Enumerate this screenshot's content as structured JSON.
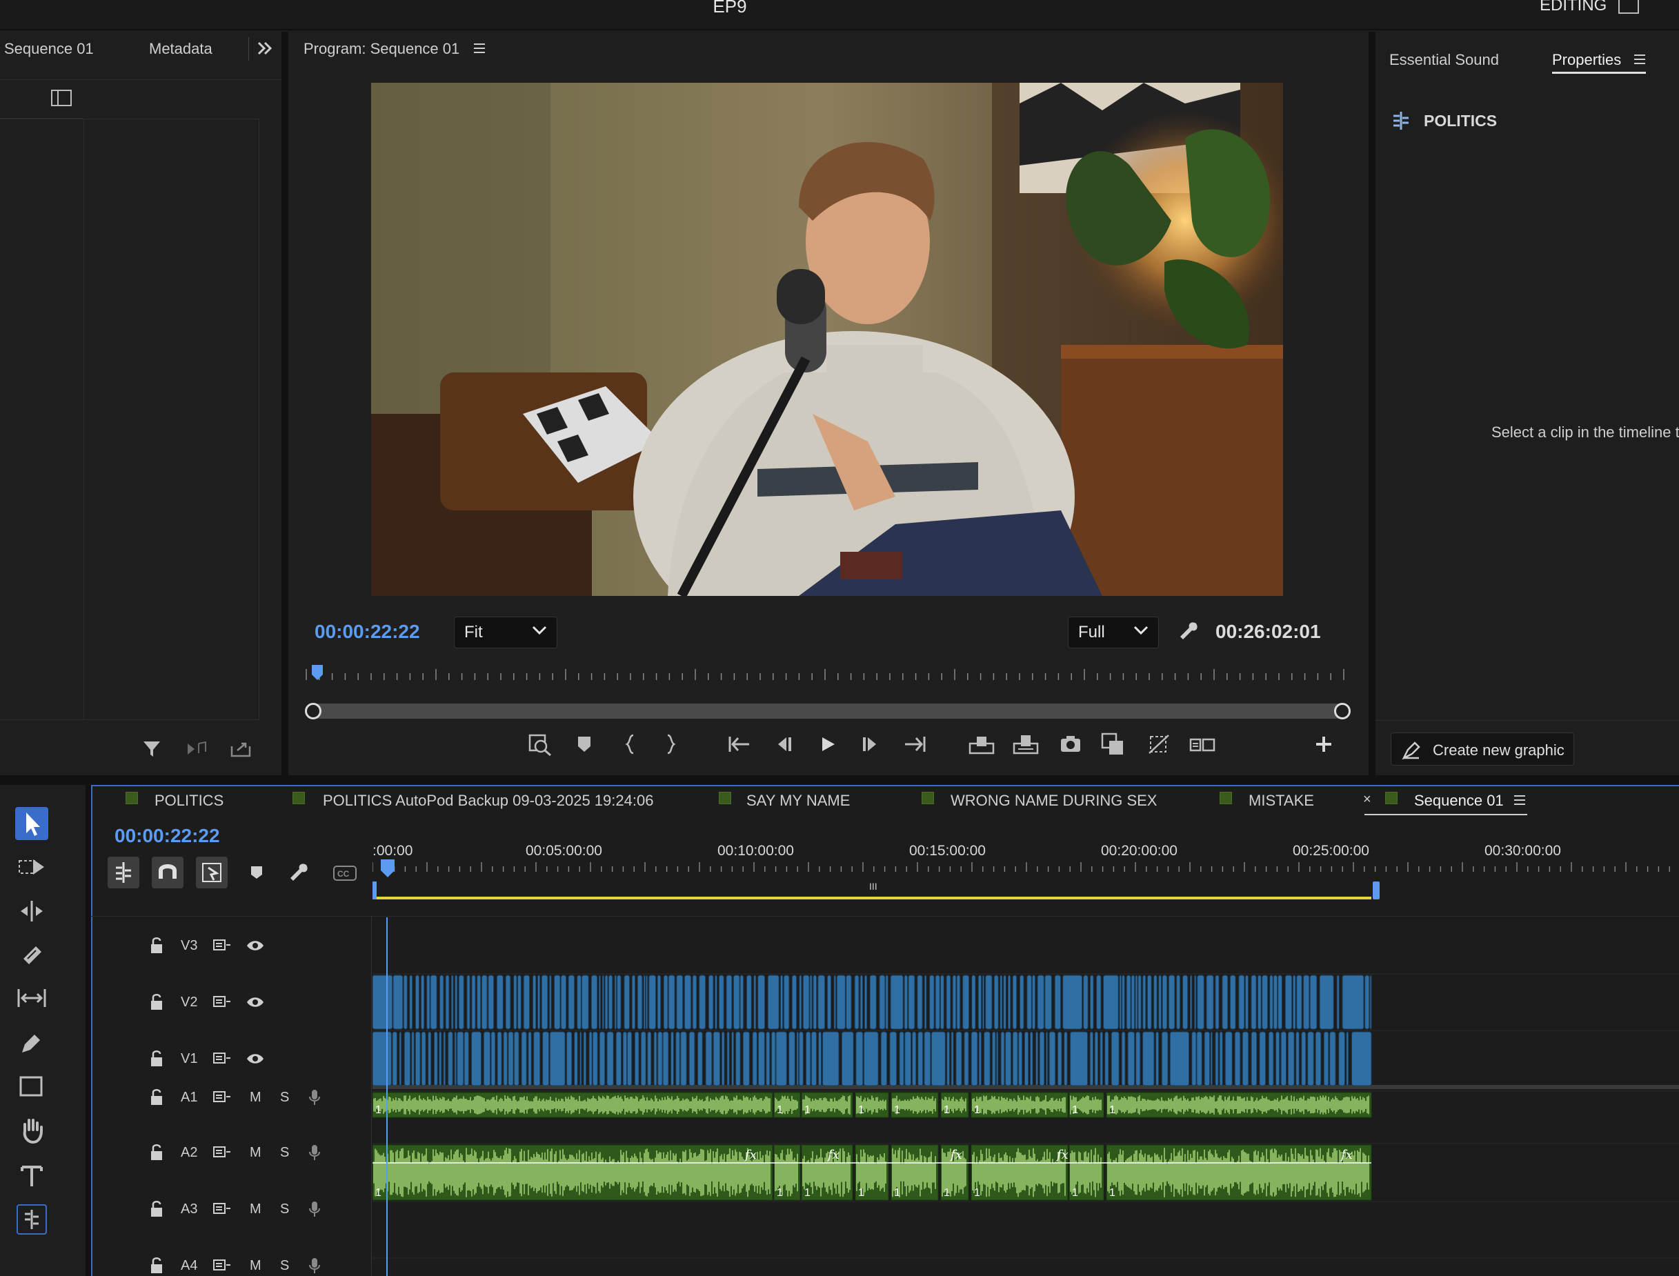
{
  "app": {
    "title": "EP9",
    "workspace": "EDITING"
  },
  "left_panel": {
    "tabs": [
      "Sequence 01",
      "Metadata"
    ],
    "more_icon": "double-chevron-right-icon"
  },
  "program": {
    "tab_label": "Program: Sequence 01",
    "current_timecode": "00:00:22:22",
    "zoom": "Fit",
    "resolution": "Full",
    "duration": "00:26:02:01",
    "playhead_fraction": 0.012
  },
  "properties": {
    "tabs": [
      "Essential Sound",
      "Properties"
    ],
    "active_tab": "Properties",
    "clip_name": "POLITICS",
    "placeholder": "Select a clip in the timeline t",
    "create_graphic_label": "Create new graphic"
  },
  "timeline": {
    "tabs": [
      {
        "label": "POLITICS",
        "swatch": true
      },
      {
        "label": "POLITICS AutoPod Backup 09-03-2025 19:24:06",
        "swatch": true
      },
      {
        "label": "SAY MY NAME",
        "swatch": true
      },
      {
        "label": "WRONG NAME DURING SEX",
        "swatch": true
      },
      {
        "label": "MISTAKE",
        "swatch": true
      },
      {
        "label": "Sequence 01",
        "swatch": true,
        "active": true
      }
    ],
    "current_timecode": "00:00:22:22",
    "ruler_labels": [
      ":00:00",
      "00:05:00:00",
      "00:10:00:00",
      "00:15:00:00",
      "00:20:00:00",
      "00:25:00:00",
      "00:30:00:00"
    ],
    "video_tracks": [
      "V3",
      "V2",
      "V1"
    ],
    "audio_tracks": [
      "A1",
      "A2",
      "A3",
      "A4"
    ],
    "mute_label": "M",
    "solo_label": "S",
    "clip_marker": "1",
    "fx_label": "fx"
  },
  "colors": {
    "accent_blue": "#5b9bf0",
    "video_clip": "#2f6fa3",
    "audio_clip": "#9ccb6f",
    "audio_dark": "#2d5a1a",
    "work_area": "#e6d43a"
  }
}
